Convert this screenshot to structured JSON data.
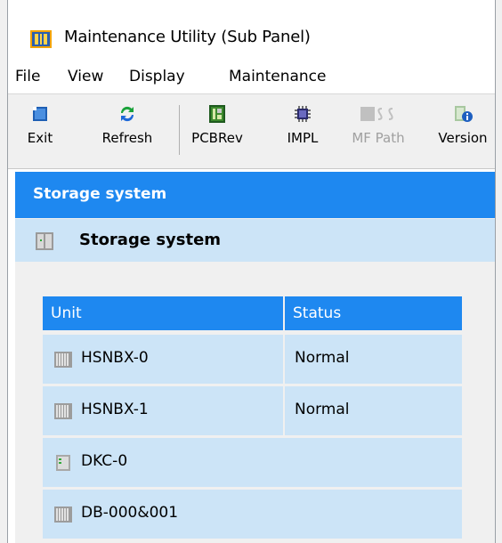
{
  "window": {
    "title": "Maintenance Utility (Sub Panel)"
  },
  "menu": {
    "items": [
      "File",
      "View",
      "Display",
      "Maintenance"
    ]
  },
  "toolbar": {
    "buttons": [
      {
        "label": "Exit",
        "icon": "exit-icon",
        "enabled": true
      },
      {
        "label": "Refresh",
        "icon": "refresh-icon",
        "enabled": true
      },
      {
        "label": "PCBRev",
        "icon": "pcb-icon",
        "enabled": true
      },
      {
        "label": "IMPL",
        "icon": "chip-icon",
        "enabled": true
      },
      {
        "label": "MF Path",
        "icon": "mf-path-icon",
        "enabled": false
      },
      {
        "label": "Version",
        "icon": "version-icon",
        "enabled": true
      }
    ]
  },
  "panel": {
    "header": "Storage system",
    "subheader": "Storage system",
    "table": {
      "columns": [
        "Unit",
        "Status"
      ],
      "rows": [
        {
          "unit": "HSNBX-0",
          "status": "Normal",
          "icon": "server-icon"
        },
        {
          "unit": "HSNBX-1",
          "status": "Normal",
          "icon": "server-icon"
        },
        {
          "unit": "DKC-0",
          "status": "",
          "icon": "controller-icon"
        },
        {
          "unit": "DB-000&001",
          "status": "",
          "icon": "server-icon"
        }
      ]
    }
  },
  "colors": {
    "accent": "#1e88f0",
    "row_bg": "#cce4f7",
    "panel_bg": "#f0f0f0"
  }
}
